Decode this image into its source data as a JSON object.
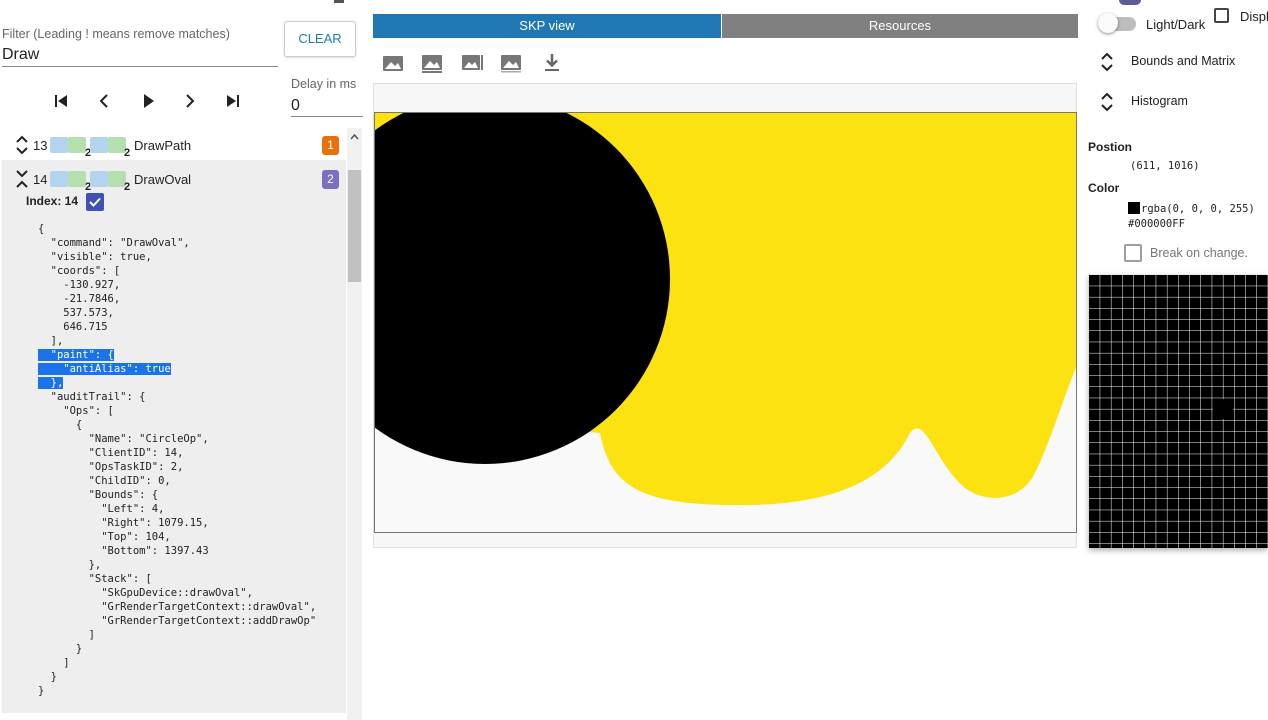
{
  "filter": {
    "label": "Filter (Leading ! means remove matches)",
    "value": "Draw",
    "clear_label": "CLEAR"
  },
  "playback": {
    "delay_label": "Delay in ms",
    "delay_value": "0",
    "buttons": [
      "skip-first-icon",
      "previous-icon",
      "play-icon",
      "next-icon",
      "skip-last-icon"
    ]
  },
  "commands": [
    {
      "index": "13",
      "subscript_a": "2",
      "subscript_b": "2",
      "name": "DrawPath",
      "count": "1",
      "badge_color": "#e8710a"
    },
    {
      "index": "14",
      "subscript_a": "2",
      "subscript_b": "2",
      "name": "DrawOval",
      "count": "2",
      "badge_color": "#7b6fc0"
    }
  ],
  "detail": {
    "index_label": "Index: 14",
    "index_checked": true,
    "json_before": "{\n  \"command\": \"DrawOval\",\n  \"visible\": true,\n  \"coords\": [\n    -130.927,\n    -21.7846,\n    537.573,\n    646.715\n  ],\n",
    "json_selected": "  \"paint\": {\n    \"antiAlias\": true\n  },\n",
    "json_after": "  \"auditTrail\": {\n    \"Ops\": [\n      {\n        \"Name\": \"CircleOp\",\n        \"ClientID\": 14,\n        \"OpsTaskID\": 2,\n        \"ChildID\": 0,\n        \"Bounds\": {\n          \"Left\": 4,\n          \"Right\": 1079.15,\n          \"Top\": 104,\n          \"Bottom\": 1397.43\n        },\n        \"Stack\": [\n          \"SkGpuDevice::drawOval\",\n          \"GrRenderTargetContext::drawOval\",\n          \"GrRenderTargetContext::addDrawOp\"\n        ]\n      }\n    ]\n  }\n}"
  },
  "tabs": {
    "active": "SKP view",
    "inactive": "Resources"
  },
  "toolbar": {
    "icons": [
      "image-icon",
      "image-checkerboard-icon",
      "image-fit-icon",
      "image-light-icon",
      "download-icon"
    ]
  },
  "canvas": {
    "background": "#f9f9f9",
    "shape_yellow": "#fde211",
    "shape_black": "#000000"
  },
  "right_panel": {
    "theme_label": "Light/Dark",
    "display_label": "Displ",
    "sections": [
      "Bounds and Matrix",
      "Histogram"
    ],
    "position_label": "Postion",
    "position_value": "(611, 1016)",
    "color_label": "Color",
    "rgba_value": "rgba(0, 0, 0, 255)",
    "hex_value": "#000000FF",
    "break_label": "Break on change."
  },
  "colors": {
    "accent": "#1f78b4",
    "highlight": "#1a73e8",
    "check": "#3f51b5"
  }
}
